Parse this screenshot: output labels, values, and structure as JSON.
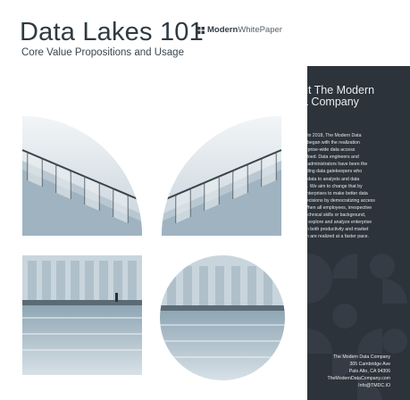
{
  "document": {
    "title": "Data Lakes 101",
    "subtitle": "Core Value Propositions and Usage",
    "brand": {
      "part1": "Modern",
      "part2": "WhitePaper",
      "icon": "grid-squares-icon"
    }
  },
  "back_page": {
    "heading_lines": [
      "ut The Modern",
      "a Company"
    ],
    "body_lines": [
      "d in 2018, The Modern Data",
      "y began with the realization",
      "erprise-wide data access",
      "siloed. Data engineers and",
      "e administrators have been the",
      "nding data gatekeepers who",
      "d data to analysts and data",
      "ts. We aim to change that by",
      "enterprises to make better data",
      "decisions by democratizing access",
      "When all employees, irrespective",
      "technical skills or background,",
      "ly explore and analyze enterprise",
      "en both productivity and market",
      "on are realized at a faster pace."
    ],
    "contact_lines": [
      "The Modern Data Company",
      "305 Cambridge Ave",
      "Palo Alto, CA 94306",
      "TheModernDataCompany.com",
      "Info@TMDC.IO"
    ]
  },
  "colors": {
    "title": "#2f3a42",
    "back_page": "#2d333b",
    "pattern": "#353c45"
  }
}
